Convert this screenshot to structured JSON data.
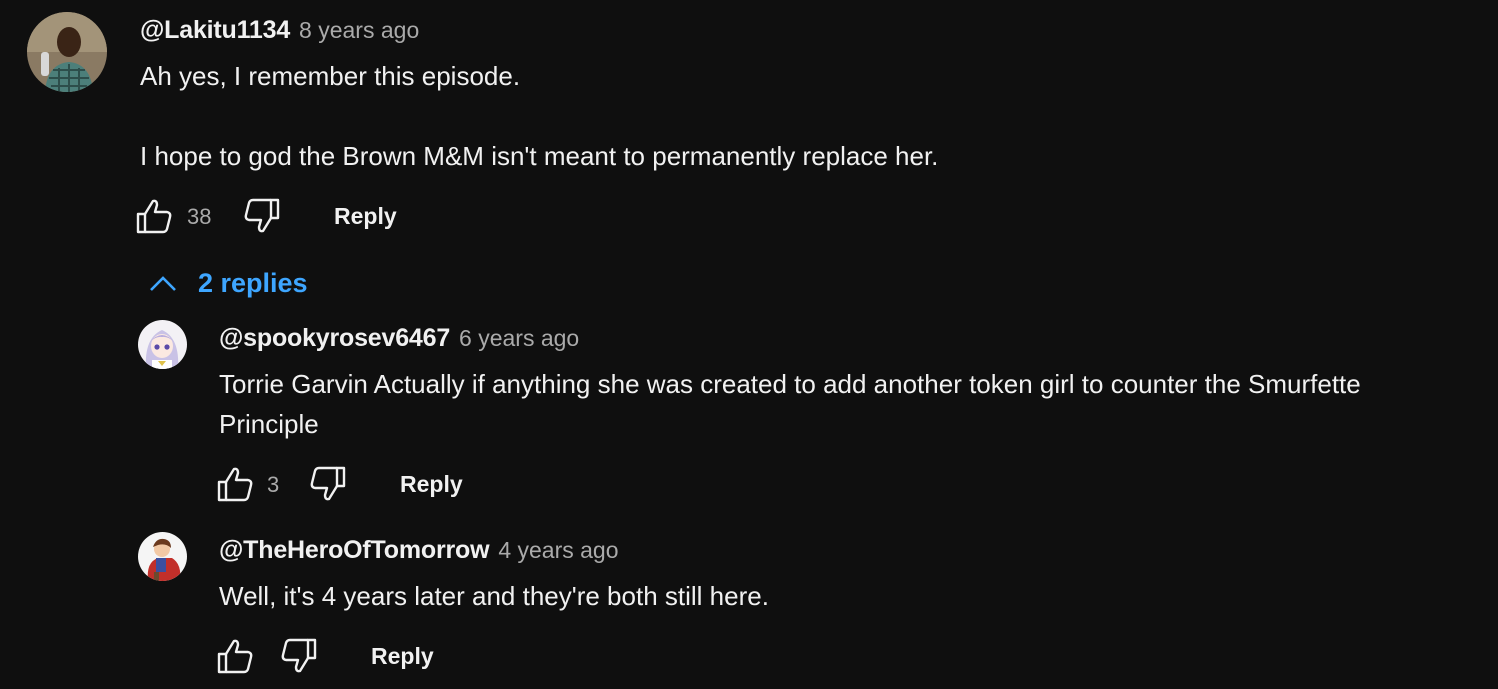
{
  "comment": {
    "author": "@Lakitu1134",
    "time": "8 years ago",
    "text": "Ah yes, I remember this episode.\n\nI hope to god the Brown M&M isn't meant to permanently replace her.",
    "likes": "38",
    "reply_label": "Reply",
    "avatar_icon": "person-avatar-icon"
  },
  "replies_toggle": {
    "label": "2 replies",
    "icon": "chevron-up-icon",
    "color": "#3ea6ff"
  },
  "replies": [
    {
      "author": "@spookyrosev6467",
      "time": "6 years ago",
      "text": "Torrie Garvin Actually if anything she was created to add another token girl to counter the Smurfette\nPrinciple",
      "likes": "3",
      "reply_label": "Reply",
      "avatar_icon": "anime-girl-avatar-icon"
    },
    {
      "author": "@TheHeroOfTomorrow",
      "time": "4 years ago",
      "text": "Well, it's 4 years later and they're both still here.",
      "likes": "",
      "reply_label": "Reply",
      "avatar_icon": "caped-hero-avatar-icon"
    }
  ],
  "colors": {
    "background": "#0f0f0f",
    "text": "#f1f1f1",
    "secondary": "#aaaaaa",
    "link": "#3ea6ff"
  }
}
